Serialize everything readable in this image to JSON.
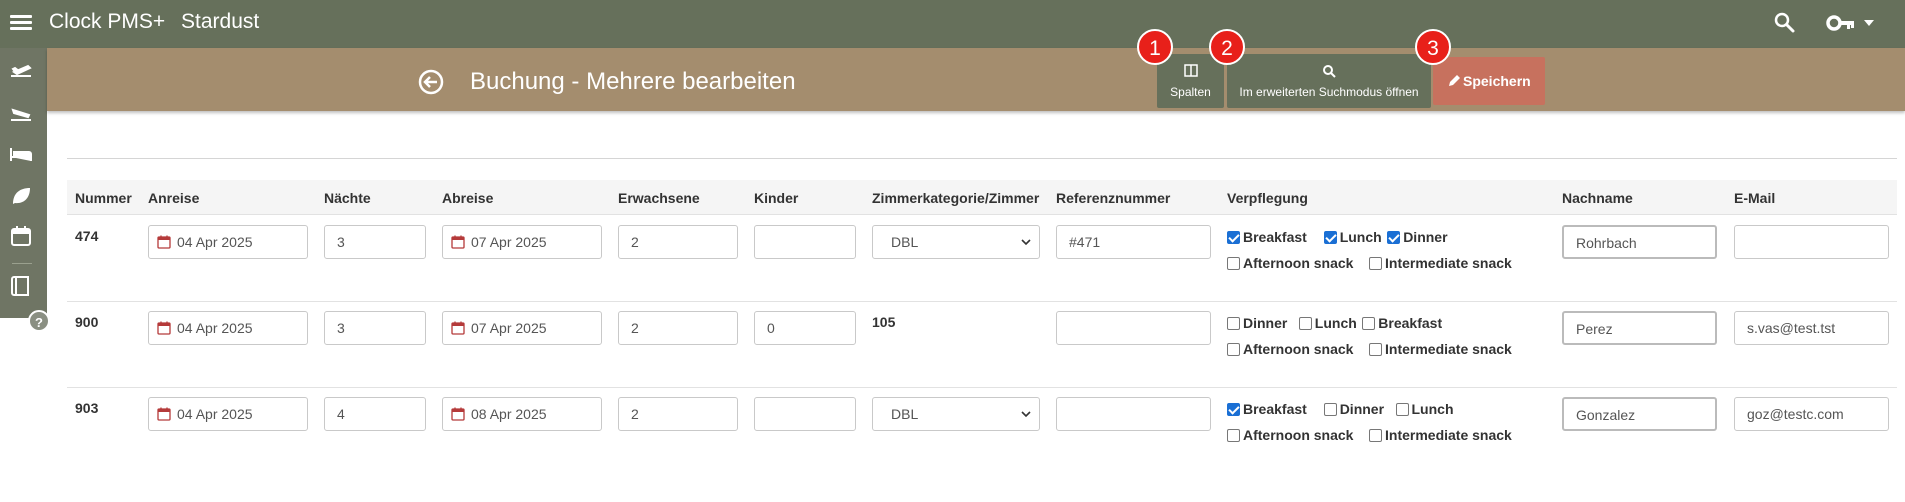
{
  "app": {
    "title": "Clock PMS+",
    "hotel": "Stardust"
  },
  "subbar": {
    "title": "Buchung - Mehrere bearbeiten",
    "columns_label": "Spalten",
    "search_label": "Im erweiterten Suchmodus öffnen",
    "save_label": "Speichern"
  },
  "badges": [
    "1",
    "2",
    "3"
  ],
  "help": "?",
  "colors": {
    "topbar": "#66705b",
    "subbar": "#a48d6e",
    "save": "#c7715e",
    "badge": "#e8201a"
  },
  "table": {
    "headers": [
      "Nummer",
      "Anreise",
      "Nächte",
      "Abreise",
      "Erwachsene",
      "Kinder",
      "Zimmerkategorie/Zimmer",
      "Referenznummer",
      "Verpflegung",
      "Nachname",
      "E-Mail"
    ],
    "rows": [
      {
        "number": "474",
        "arrival": "04 Apr 2025",
        "nights": "3",
        "departure": "07 Apr 2025",
        "adults": "2",
        "children": "",
        "room": "DBL",
        "room_is_select": true,
        "reference": "#471",
        "meals_line1": [
          {
            "label": "Breakfast",
            "checked": true
          },
          {
            "label": "Lunch",
            "checked": true
          },
          {
            "label": "Dinner",
            "checked": true
          }
        ],
        "meals_line2": [
          {
            "label": "Afternoon snack",
            "checked": false
          },
          {
            "label": "Intermediate snack",
            "checked": false
          }
        ],
        "lastname": "Rohrbach",
        "email": ""
      },
      {
        "number": "900",
        "arrival": "04 Apr 2025",
        "nights": "3",
        "departure": "07 Apr 2025",
        "adults": "2",
        "children": "0",
        "room": "105",
        "room_is_select": false,
        "reference": "",
        "meals_line1": [
          {
            "label": "Dinner",
            "checked": false
          },
          {
            "label": "Lunch",
            "checked": false
          },
          {
            "label": "Breakfast",
            "checked": false
          }
        ],
        "meals_line2": [
          {
            "label": "Afternoon snack",
            "checked": false
          },
          {
            "label": "Intermediate snack",
            "checked": false
          }
        ],
        "lastname": "Perez",
        "email": "s.vas@test.tst"
      },
      {
        "number": "903",
        "arrival": "04 Apr 2025",
        "nights": "4",
        "departure": "08 Apr 2025",
        "adults": "2",
        "children": "",
        "room": "DBL",
        "room_is_select": true,
        "reference": "",
        "meals_line1": [
          {
            "label": "Breakfast",
            "checked": true
          },
          {
            "label": "Dinner",
            "checked": false
          },
          {
            "label": "Lunch",
            "checked": false
          }
        ],
        "meals_line2": [
          {
            "label": "Afternoon snack",
            "checked": false
          },
          {
            "label": "Intermediate snack",
            "checked": false
          }
        ],
        "lastname": "Gonzalez",
        "email": "goz@testc.com"
      }
    ]
  }
}
